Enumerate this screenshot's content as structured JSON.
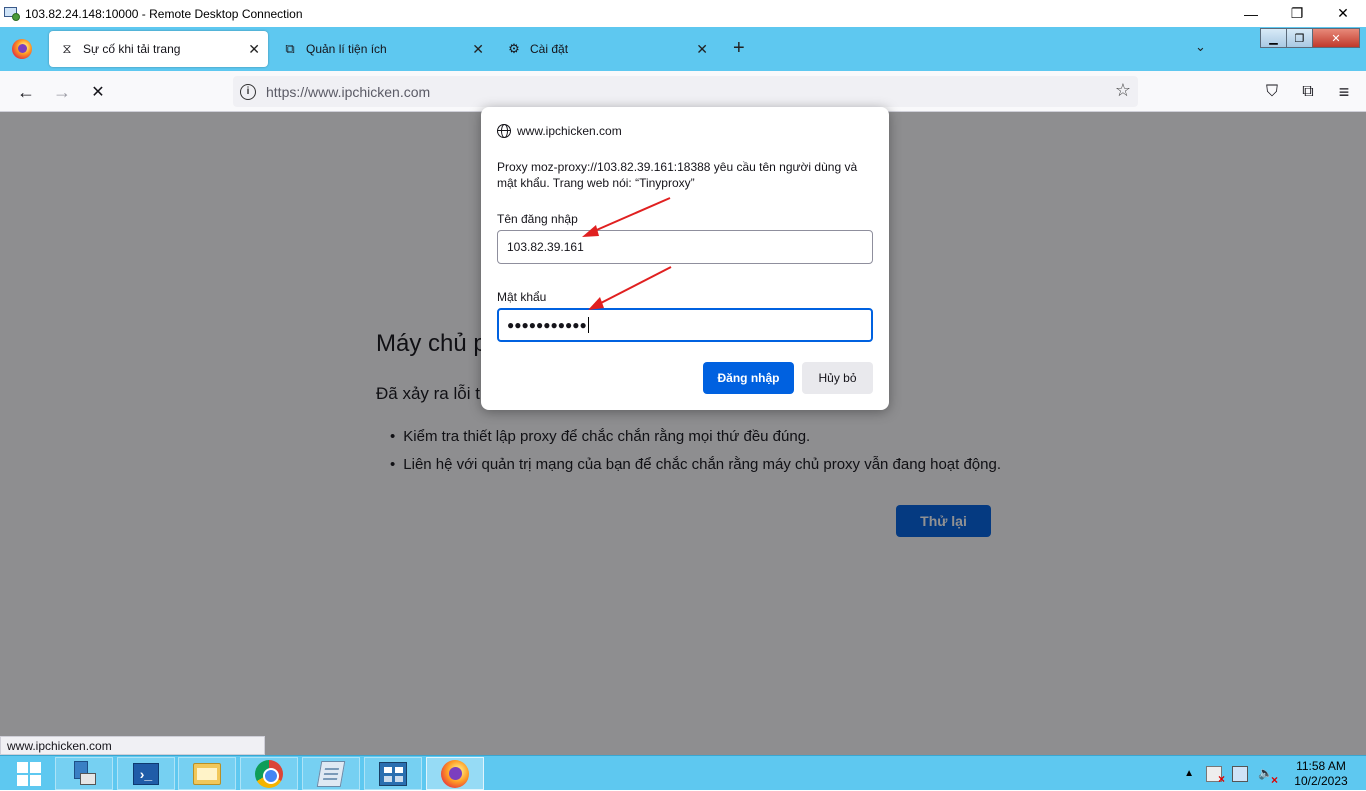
{
  "rdp": {
    "title": "103.82.24.148:10000 - Remote Desktop Connection",
    "min": "—",
    "restore": "❐",
    "close": "✕"
  },
  "tabs": [
    {
      "label": "Sự cố khi tải trang",
      "icon": "hourglass-icon",
      "glyph": "⧖",
      "close": "✕"
    },
    {
      "label": "Quản lí tiện ích",
      "icon": "puzzle-icon",
      "glyph": "⧉",
      "close": "✕"
    },
    {
      "label": "Cài đặt",
      "icon": "gear-icon",
      "glyph": "⚙",
      "close": "✕"
    }
  ],
  "tabstrip": {
    "new_tab": "+",
    "list_all": "⌄"
  },
  "guest_ctrls": {
    "min": "▁",
    "restore": "❐",
    "close": "✕"
  },
  "navbar": {
    "back": "←",
    "forward": "→",
    "stop": "✕",
    "url": "https://www.ipchicken.com",
    "info": "i",
    "star": "☆",
    "pocket": "⛉",
    "extensions": "⧉",
    "menu": "≡"
  },
  "error_page": {
    "title": "Máy chủ p",
    "description": "Đã xảy ra lỗi t",
    "items": [
      "Kiểm tra thiết lập proxy để chắc chắn rằng mọi thứ đều đúng.",
      "Liên hệ với quản trị mạng của bạn để chắc chắn rằng máy chủ proxy vẫn đang hoạt động."
    ],
    "retry": "Thử lại"
  },
  "status_link": "www.ipchicken.com",
  "dialog": {
    "host": "www.ipchicken.com",
    "message": "Proxy moz-proxy://103.82.39.161:18388 yêu cầu tên người dùng và mật khẩu. Trang web nói: “Tinyproxy”",
    "username_label": "Tên đăng nhập",
    "username_value": "103.82.39.161",
    "password_label": "Mật khẩu",
    "password_masked": "●●●●●●●●●●●",
    "login": "Đăng nhập",
    "cancel": "Hủy bỏ"
  },
  "annotation": {
    "arrow_color": "#e02020"
  },
  "taskbar": {
    "apps": [
      "start",
      "server-manager",
      "powershell",
      "file-explorer",
      "chrome",
      "notepad",
      "control-panel",
      "firefox"
    ],
    "tray_arrow": "▲",
    "time": "11:58 AM",
    "date": "10/2/2023"
  },
  "colors": {
    "tabstrip": "#5ec8f0",
    "accent": "#0061e0",
    "taskbar": "#5ec8f0"
  }
}
